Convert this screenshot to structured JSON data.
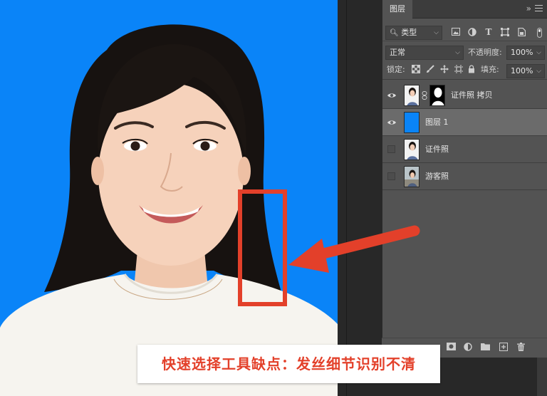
{
  "panel": {
    "tab_label": "图层",
    "collapse_glyph": "»",
    "filter": {
      "value": "类型",
      "icons": [
        "image-filter-icon",
        "adjustment-filter-icon",
        "type-filter-icon",
        "shape-filter-icon",
        "smart-object-filter-icon"
      ]
    },
    "blend_mode": "正常",
    "opacity_label": "不透明度:",
    "opacity_value": "100%",
    "lock_label": "锁定:",
    "fill_label": "填充:",
    "fill_value": "100%",
    "layers": [
      {
        "name": "证件照 拷贝",
        "visible": true,
        "selected": false,
        "has_mask": true
      },
      {
        "name": "图层 1",
        "visible": true,
        "selected": true,
        "has_mask": false
      },
      {
        "name": "证件照",
        "visible": false,
        "selected": false,
        "has_mask": false
      },
      {
        "name": "游客照",
        "visible": false,
        "selected": false,
        "has_mask": false
      }
    ]
  },
  "annotation": {
    "caption": "快速选择工具缺点：发丝细节识别不清",
    "color": "#e3402a"
  },
  "colors": {
    "canvas_background": "#0a84f8",
    "panel_background": "#535353",
    "selected_layer": "#6b6b6b"
  }
}
